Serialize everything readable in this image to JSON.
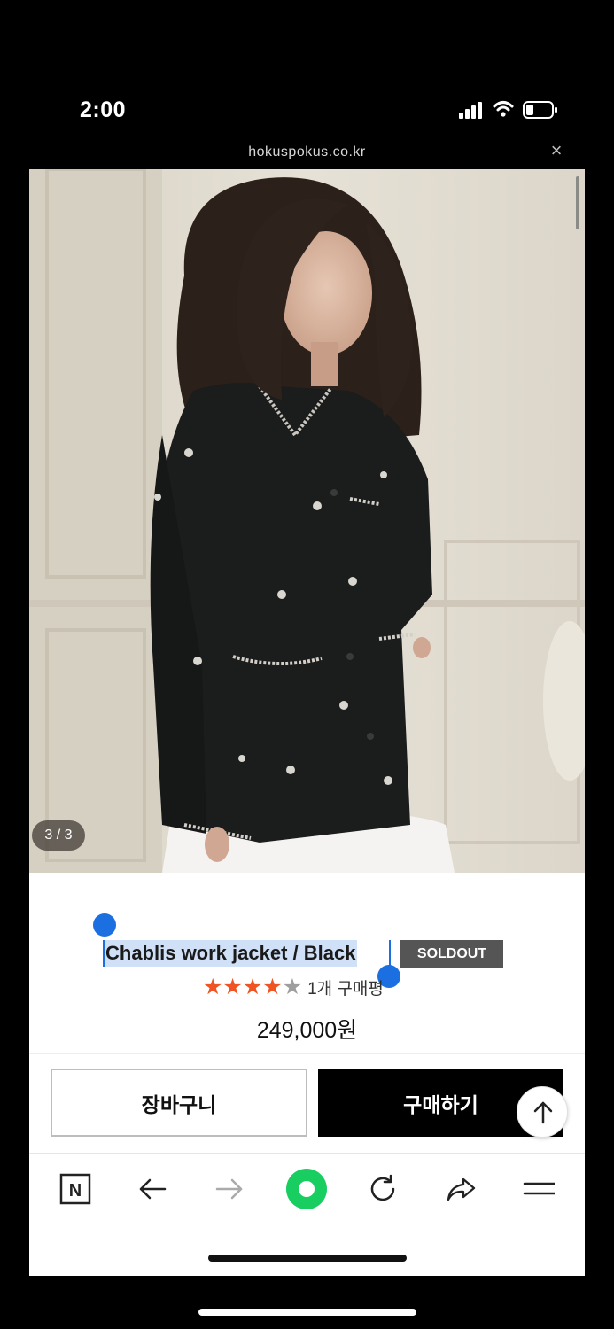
{
  "status_bar": {
    "time": "2:00"
  },
  "browser": {
    "url": "hokuspokus.co.kr",
    "close_symbol": "×"
  },
  "product": {
    "image_counter": "3 / 3",
    "image_description_icon": "product-photo",
    "title": "Chablis work jacket / Black",
    "badge": "SOLDOUT",
    "rating_stars": 4,
    "rating_max": 5,
    "review_count_text": "1개 구매평",
    "price": "249,000원"
  },
  "actions": {
    "cart_label": "장바구니",
    "buy_label": "구매하기",
    "top_icon": "arrow-up-icon"
  },
  "nav_bar": {
    "items": [
      "naver-home-icon",
      "back-arrow-icon",
      "forward-arrow-icon",
      "green-home-icon",
      "refresh-icon",
      "share-icon",
      "menu-icon"
    ],
    "naver_letter": "N"
  },
  "colors": {
    "star_filled": "#f05423",
    "star_empty": "#9e9e9e",
    "selection": "#cfe0f7",
    "selection_handle": "#1b6fe0",
    "green_home": "#19ce60",
    "badge_bg": "#555555"
  }
}
